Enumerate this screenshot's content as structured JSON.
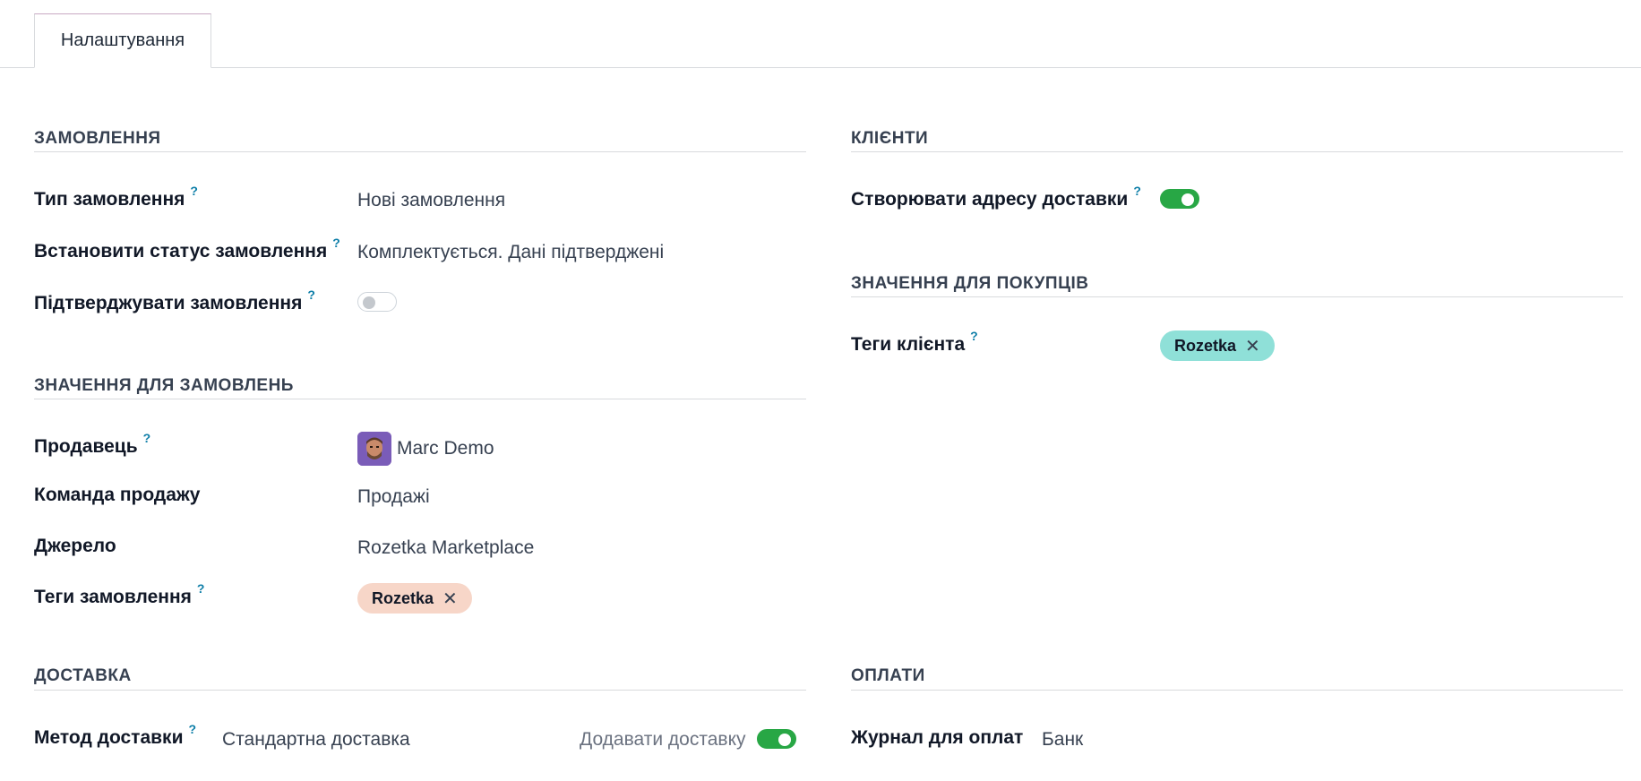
{
  "tabs": [
    {
      "label": "Налаштування"
    }
  ],
  "orders": {
    "title": "ЗАМОВЛЕННЯ",
    "order_type": {
      "label": "Тип замовлення",
      "value": "Нові замовлення"
    },
    "set_status": {
      "label": "Встановити статус замовлення",
      "value": "Комплектується. Дані підтверджені"
    },
    "confirm": {
      "label": "Підтверджувати замовлення",
      "enabled": false
    }
  },
  "order_values": {
    "title": "ЗНАЧЕННЯ ДЛЯ ЗАМОВЛЕНЬ",
    "salesperson": {
      "label": "Продавець",
      "value": "Marc Demo"
    },
    "sales_team": {
      "label": "Команда продажу",
      "value": "Продажі"
    },
    "source": {
      "label": "Джерело",
      "value": "Rozetka Marketplace"
    },
    "order_tags": {
      "label": "Теги замовлення",
      "tags": [
        "Rozetka"
      ],
      "tag_color": "#f7d6c8"
    }
  },
  "clients": {
    "title": "КЛІЄНТИ",
    "create_address": {
      "label": "Створювати адресу доставки",
      "enabled": true
    }
  },
  "buyer_values": {
    "title": "ЗНАЧЕННЯ ДЛЯ ПОКУПЦІВ",
    "client_tags": {
      "label": "Теги клієнта",
      "tags": [
        "Rozetka"
      ],
      "tag_color": "#8fe0d8"
    }
  },
  "delivery": {
    "title": "ДОСТАВКА",
    "method": {
      "label": "Метод доставки",
      "value": "Стандартна доставка"
    },
    "add_delivery": {
      "label": "Додавати доставку",
      "enabled": true
    }
  },
  "payments": {
    "title": "ОПЛАТИ",
    "journal": {
      "label": "Журнал для оплат",
      "value": "Банк"
    }
  },
  "help_mark": "?",
  "tag_remove_glyph": "✕",
  "colors": {
    "toggle_on": "#28a745",
    "help": "#0d7ea8"
  }
}
